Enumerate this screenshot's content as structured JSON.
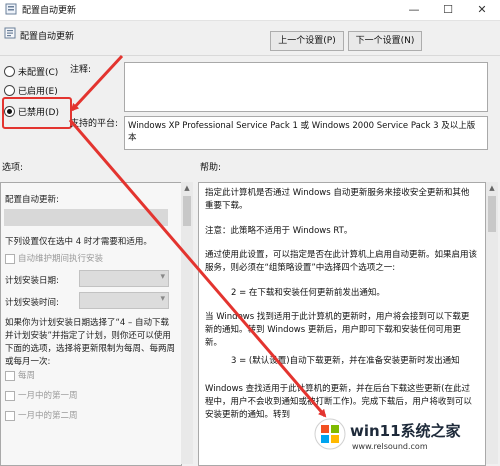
{
  "window": {
    "title": "配置自动更新",
    "minimize_glyph": "—",
    "maximize_glyph": "☐",
    "close_glyph": "✕"
  },
  "header": {
    "setting_name": "配置自动更新",
    "prev_button": "上一个设置(P)",
    "next_button": "下一个设置(N)"
  },
  "state": {
    "options": [
      {
        "label": "未配置(C)",
        "selected": false
      },
      {
        "label": "已启用(E)",
        "selected": false
      },
      {
        "label": "已禁用(D)",
        "selected": true
      }
    ]
  },
  "comment": {
    "label": "注释:",
    "value": ""
  },
  "supported": {
    "label": "支持的平台:",
    "value": "Windows XP Professional Service Pack 1 或 Windows 2000 Service Pack 3 及以上版本"
  },
  "options_section": {
    "label": "选项:",
    "title": "配置自动更新:",
    "note": "下列设置仅在选中 4 时才需要和适用。",
    "maintenance_checkbox": "自动维护期间执行安装",
    "schedule_day_label": "计划安装日期:",
    "schedule_time_label": "计划安装时间:",
    "paragraph": "如果你为计划安装日期选择了“4 – 自动下载并计划安装”并指定了计划，则你还可以使用下面的选项，选择将更新限制为每周、每两周或每月一次:",
    "weekly_checkbox": "每周",
    "first_week_checkbox": "一月中的第一周",
    "second_week_checkbox": "一月中的第二周"
  },
  "help_section": {
    "label": "帮助:",
    "paragraphs": [
      "指定此计算机是否通过 Windows 自动更新服务来接收安全更新和其他重要下载。",
      "注意：此策略不适用于 Windows RT。",
      "通过使用此设置，可以指定是否在此计算机上启用自动更新。如果启用该服务，则必须在“组策略设置”中选择四个选项之一:",
      "2 = 在下载和安装任何更新前发出通知。",
      "当 Windows 找到适用于此计算机的更新时，用户将会接到可以下载更新的通知。转到 Windows 更新后，用户即可下载和安装任何可用更新。",
      "3 = (默认设置)自动下载更新，并在准备安装更新时发出通知",
      "Windows 查找适用于此计算机的更新，并在后台下载这些更新(在此过程中，用户不会收到通知或被打断工作)。完成下载后，用户将收到可以安装更新的通知。转到"
    ]
  },
  "watermark": {
    "title": "win11系统之家",
    "url": "www.relsound.com"
  },
  "colors": {
    "annotation_red": "#e3342f"
  }
}
